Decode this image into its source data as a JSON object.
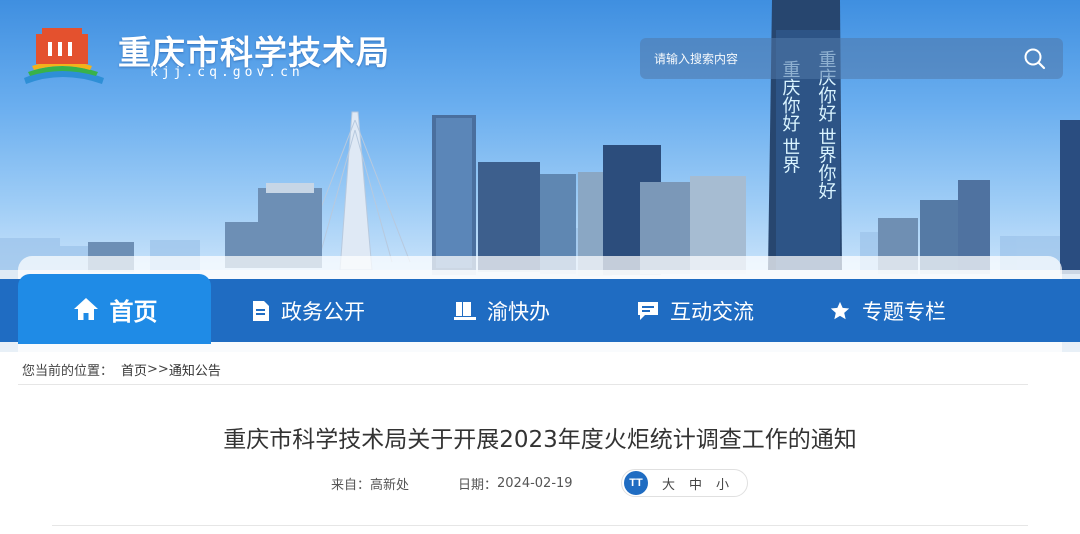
{
  "header": {
    "site_title": "重庆市科学技术局",
    "site_domain": "kjj.cq.gov.cn",
    "search_placeholder": "请输入搜索内容",
    "tower_text_left": "重庆你好 世界",
    "tower_text_right": "重庆你好 世界你好"
  },
  "nav": {
    "items": [
      {
        "label": "首页",
        "icon": "home-icon",
        "active": true
      },
      {
        "label": "政务公开",
        "icon": "document-icon"
      },
      {
        "label": "渝快办",
        "icon": "book-icon"
      },
      {
        "label": "互动交流",
        "icon": "chat-icon"
      },
      {
        "label": "专题专栏",
        "icon": "star-icon"
      }
    ]
  },
  "breadcrumb": {
    "prefix": "您当前的位置：",
    "home": "首页",
    "separator": ">>",
    "current": "通知公告"
  },
  "article": {
    "title": "重庆市科学技术局关于开展2023年度火炬统计调查工作的通知",
    "source_label": "来自：",
    "source": "高新处",
    "date_label": "日期：",
    "date": "2024-02-19",
    "font_size_icon": "TT",
    "font_sizes": [
      "大",
      "中",
      "小"
    ]
  },
  "colors": {
    "nav_bg": "#1f6cc2",
    "nav_active": "#1f8be6",
    "sky_top": "#3f8fe0"
  }
}
